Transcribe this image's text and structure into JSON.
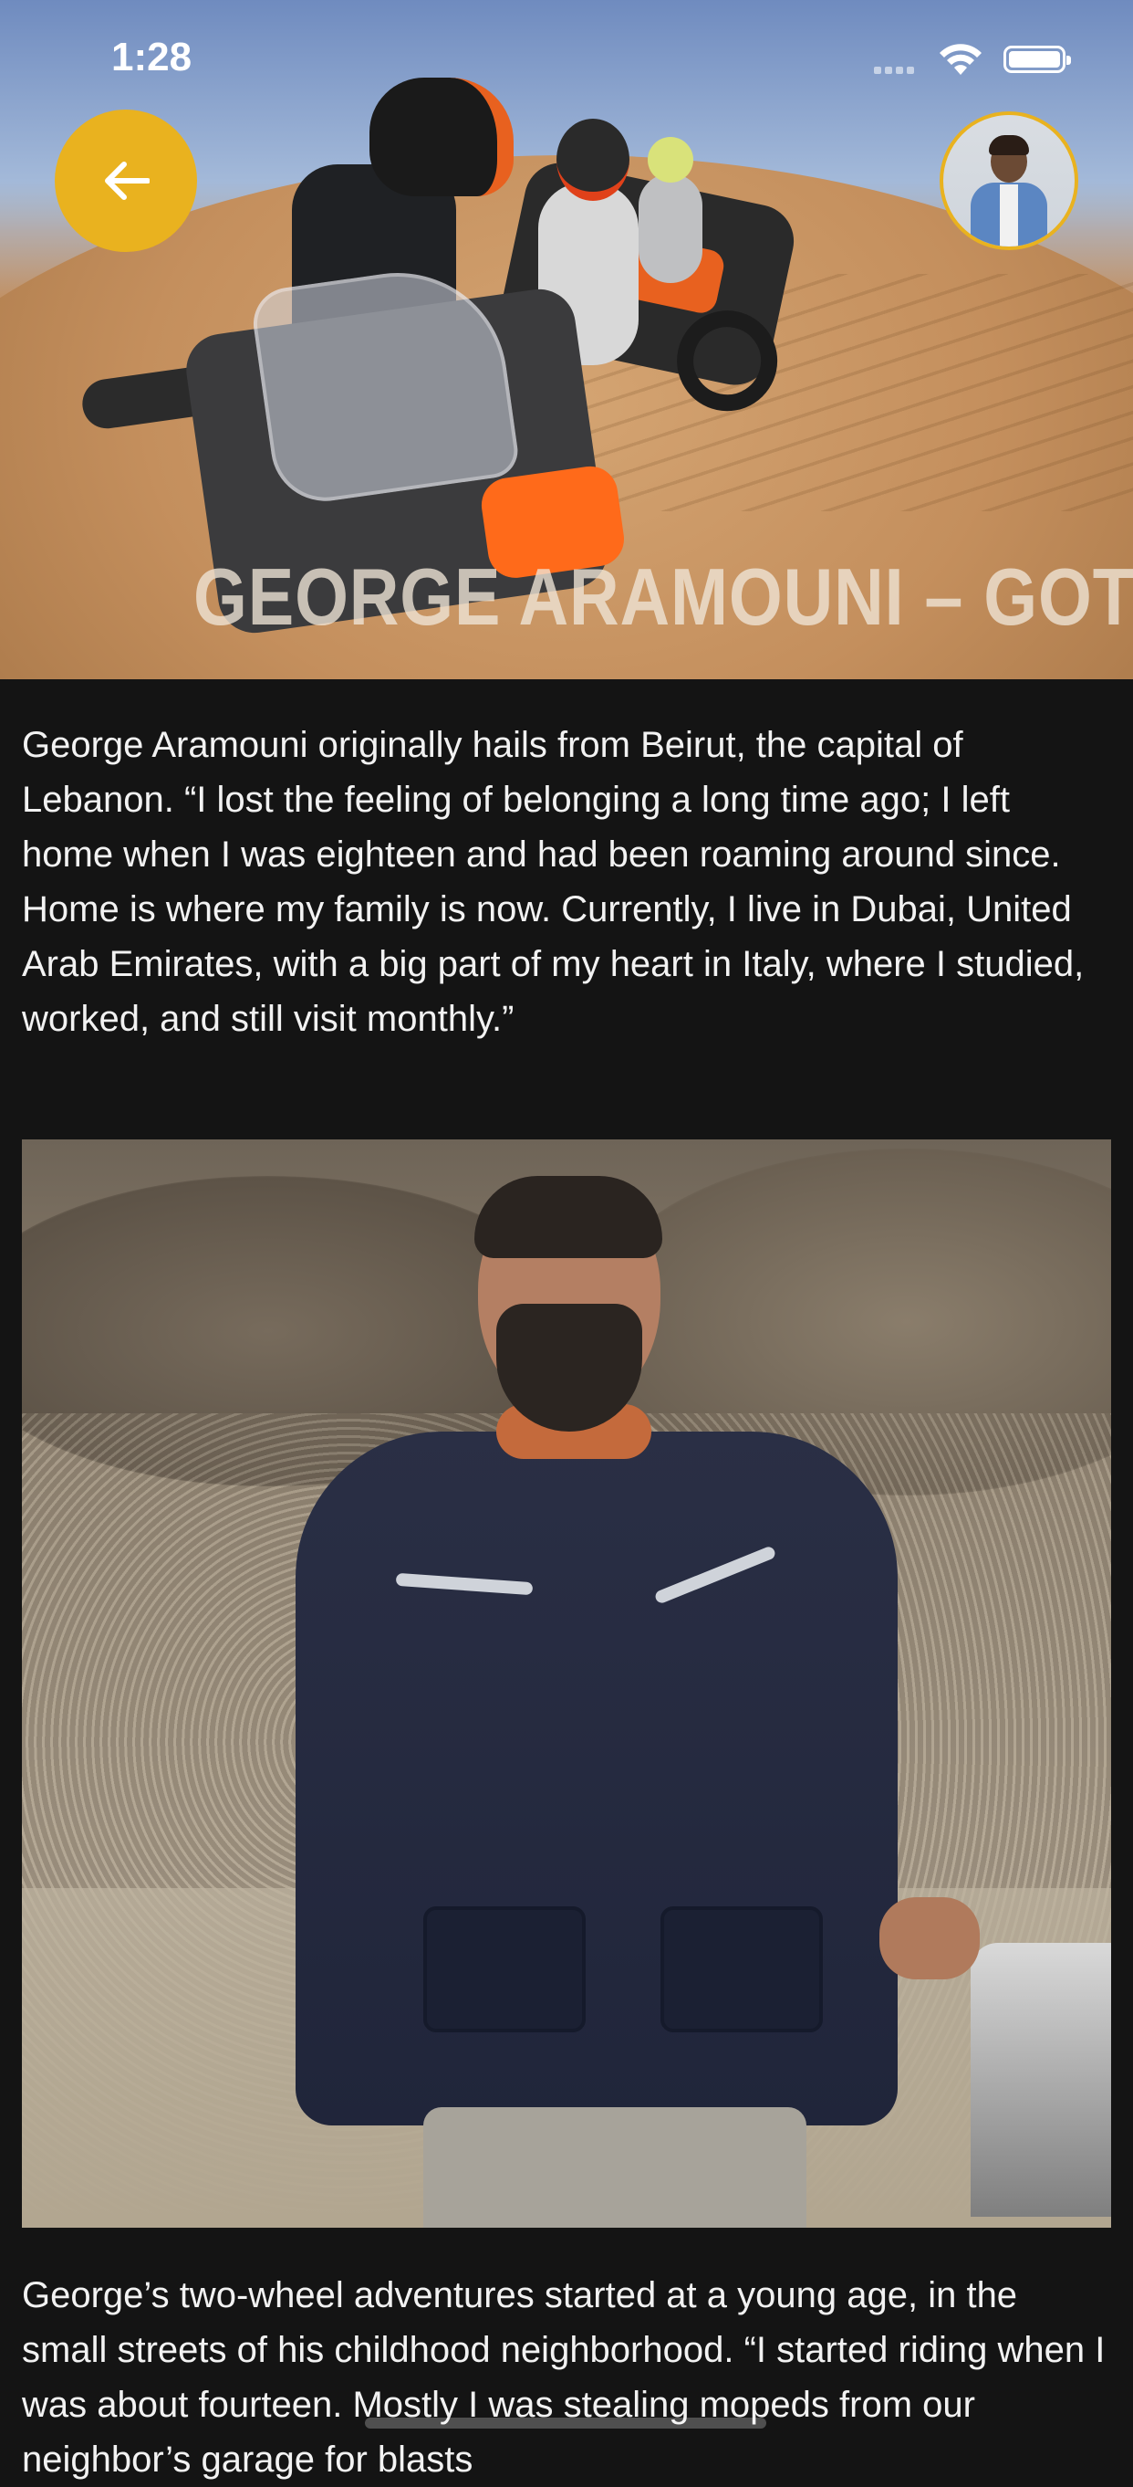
{
  "status_bar": {
    "time": "1:28"
  },
  "header": {
    "back_icon": "arrow-left-icon",
    "avatar_icon": "user-avatar",
    "accent_color": "#E9B21F"
  },
  "hero": {
    "caption": "GEORGE ARAMOUNI – GOT"
  },
  "article": {
    "paragraph_1": "George Aramouni originally hails from Beirut, the capital of Lebanon. “I lost the feeling of belonging a long time ago; I left home when I was eighteen and had been roaming around since. Home is where my family is now. Currently, I live in Dubai, United Arab Emirates, with a big part of my heart in Italy, where I studied, worked, and still visit monthly.”",
    "paragraph_2": "George’s two-wheel adventures started at a young age, in the small streets of his childhood neighborhood. “I started riding when I was about fourteen. Mostly I was stealing mopeds from our neighbor’s garage for blasts"
  }
}
